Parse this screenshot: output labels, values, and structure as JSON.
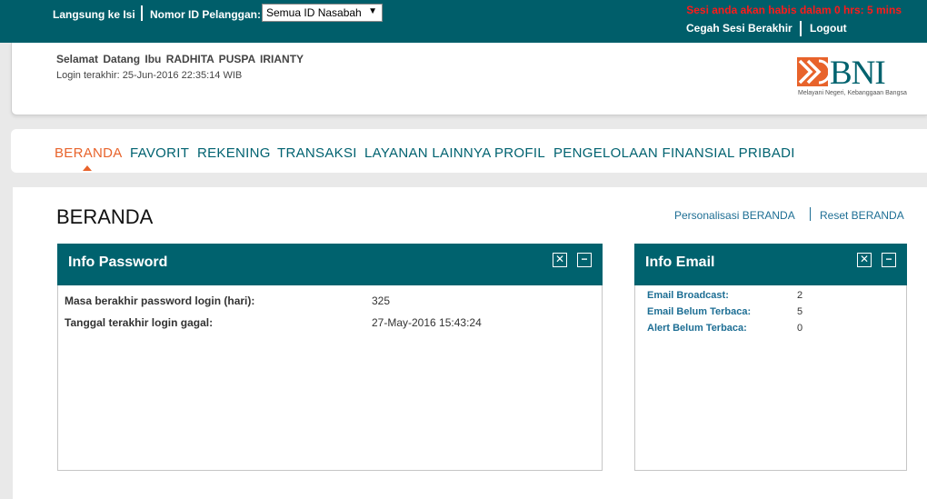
{
  "topbar": {
    "skip_link": "Langsung ke Isi",
    "customer_id_label": "Nomor ID Pelanggan:",
    "customer_id_selected": "Semua ID Nasabah",
    "session_notice": "Sesi anda akan habis dalam 0 hrs: 5 mins",
    "prevent_session_end": "Cegah Sesi Berakhir",
    "logout": "Logout"
  },
  "header": {
    "welcome": "Selamat Datang Ibu  RADHITA  PUSPA  IRIANTY",
    "last_login": "Login terakhir:  25-Jun-2016 22:35:14  WIB",
    "logo_text": "BNI",
    "logo_tagline": "Melayani Negeri, Kebanggaan Bangsa"
  },
  "nav": {
    "items": [
      "BERANDA",
      "FAVORIT",
      "REKENING",
      "TRANSAKSI",
      "LAYANAN LAINNYA",
      "PROFIL",
      "PENGELOLAAN FINANSIAL PRIBADI"
    ],
    "active": "BERANDA"
  },
  "main": {
    "title": "BERANDA",
    "personalize_link": "Personalisasi BERANDA",
    "reset_link": "Reset BERANDA"
  },
  "info_password": {
    "title": "Info Password",
    "close_icon": "✕",
    "minimize_icon": "−",
    "rows": [
      {
        "label": "Masa berakhir password login (hari):",
        "value": "325"
      },
      {
        "label": "Tanggal terakhir login gagal:",
        "value": "27-May-2016 15:43:24"
      }
    ]
  },
  "info_email": {
    "title": "Info Email",
    "close_icon": "✕",
    "minimize_icon": "−",
    "rows": [
      {
        "label": "Email Broadcast:",
        "value": "2"
      },
      {
        "label": "Email Belum Terbaca:",
        "value": "5"
      },
      {
        "label": "Alert Belum Terbaca:",
        "value": "0"
      }
    ]
  },
  "colors": {
    "brand_teal": "#005e6a",
    "accent_orange": "#e8632b",
    "link_blue": "#1d6e94",
    "session_red": "#ff1a1a"
  }
}
